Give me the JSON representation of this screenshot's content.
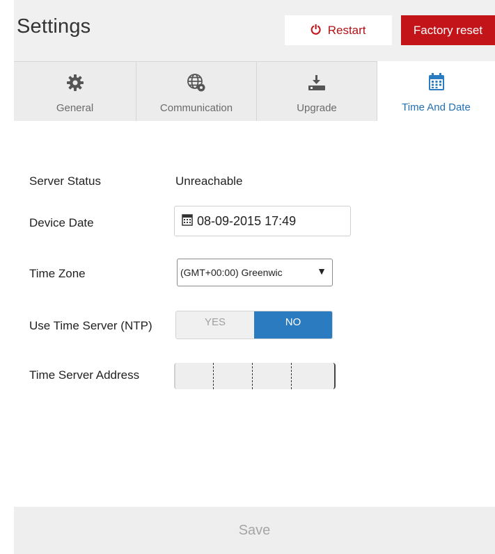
{
  "header": {
    "title": "Settings",
    "restart_label": "Restart",
    "factory_reset_label": "Factory reset"
  },
  "tabs": [
    {
      "label": "General",
      "icon": "gear-icon",
      "active": false
    },
    {
      "label": "Communication",
      "icon": "globe-gear-icon",
      "active": false
    },
    {
      "label": "Upgrade",
      "icon": "upgrade-download-icon",
      "active": false
    },
    {
      "label": "Time And Date",
      "icon": "calendar-icon",
      "active": true
    }
  ],
  "form": {
    "server_status": {
      "label": "Server Status",
      "value": "Unreachable"
    },
    "device_date": {
      "label": "Device Date",
      "value": "08-09-2015 17:49"
    },
    "time_zone": {
      "label": "Time Zone",
      "value": "(GMT+00:00) Greenwic"
    },
    "use_time_server": {
      "label": "Use Time Server (NTP)",
      "yes_label": "YES",
      "no_label": "NO",
      "selected": "NO"
    },
    "time_server_address": {
      "label": "Time Server Address",
      "value": ""
    }
  },
  "footer": {
    "save_label": "Save"
  },
  "colors": {
    "accent_red": "#c3141a",
    "accent_blue": "#2b7bc0",
    "header_bg": "#f0f0f0"
  }
}
